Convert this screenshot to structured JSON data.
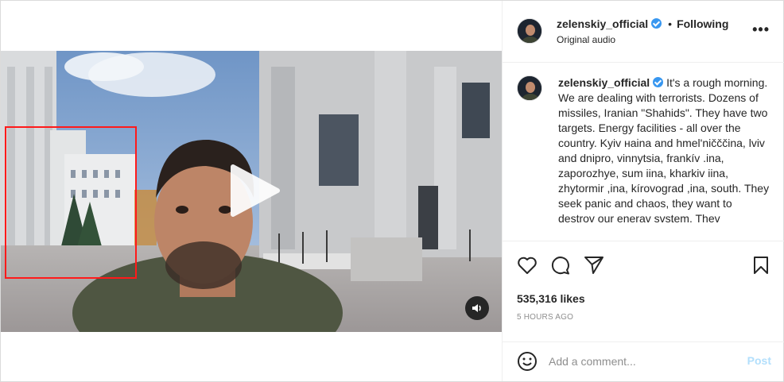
{
  "header": {
    "username": "zelenskiy_official",
    "separator": "•",
    "follow_state": "Following",
    "audio_label": "Original audio",
    "more_label": "•••"
  },
  "caption": {
    "username": "zelenskiy_official",
    "text": "It's a rough morning. We are dealing with terrorists. Dozens of missiles, Iranian \"Shahids\". They have two targets. Energy facilities - all over the country. Kyiv наіna and hmel'ničččina, lviv and dnipro, vinnytsia, frankív .ina, zaporozhye, sum iina, kharkiv iina, zhytormir ,ina, kírovograd ,ina, south. They seek panic and chaos, they want to destrov our enerav svstem. Thev"
  },
  "actions": {
    "likes": "535,316 likes",
    "time": "5 HOURS AGO"
  },
  "comment": {
    "placeholder": "Add a comment...",
    "post_label": "Post"
  },
  "colors": {
    "accent": "#3897f0",
    "post_disabled": "#b2dffc",
    "annotation_box": "#ff1a1a"
  },
  "icons": [
    "verified-badge-icon",
    "like-heart-icon",
    "comment-bubble-icon",
    "share-plane-icon",
    "save-bookmark-icon",
    "emoji-icon",
    "play-icon",
    "sound-icon"
  ]
}
